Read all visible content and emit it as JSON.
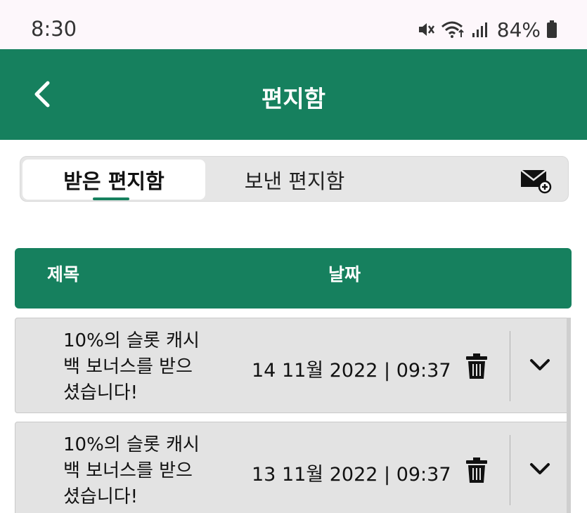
{
  "status_bar": {
    "time": "8:30",
    "battery": "84%",
    "icons": [
      "mute-icon",
      "wifi-icon",
      "signal-icon",
      "battery-icon"
    ]
  },
  "header": {
    "title": "편지함",
    "back_icon": "chevron-left-icon"
  },
  "tabs": {
    "inbox_label": "받은 편지함",
    "sent_label": "보낸 편지함",
    "selected": "inbox",
    "compose_icon": "mail-add-icon"
  },
  "table": {
    "columns": {
      "subject": "제목",
      "date": "날짜"
    },
    "rows": [
      {
        "subject_lines": [
          "10%의 슬롯 캐시",
          "백 보너스를 받으",
          "셨습니다!"
        ],
        "date": "14 11월 2022 | 09:37"
      },
      {
        "subject_lines": [
          "10%의 슬롯 캐시",
          "백 보너스를 받으",
          "셨습니다!"
        ],
        "date": "13 11월 2022 | 09:37"
      }
    ]
  },
  "colors": {
    "primary": "#16805e",
    "row_background": "#e3e3e3",
    "status_background": "#fdf7fb"
  }
}
